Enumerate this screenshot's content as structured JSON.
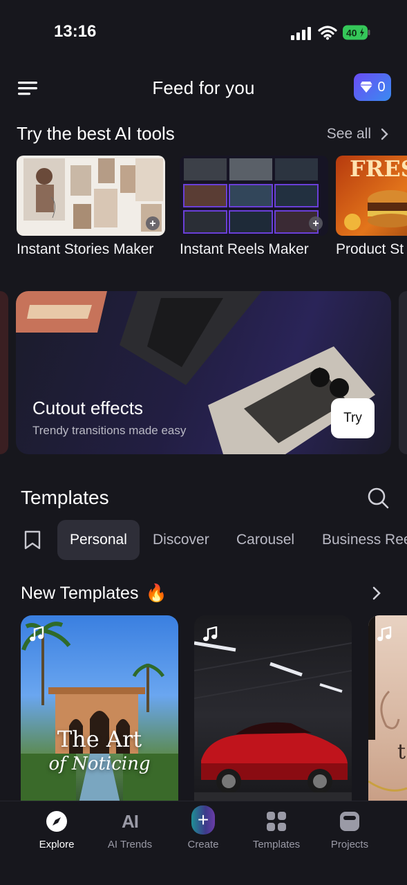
{
  "status_bar": {
    "time": "13:16",
    "battery": "40"
  },
  "header": {
    "title": "Feed for you",
    "gem_count": "0"
  },
  "ai_tools": {
    "title": "Try the best AI tools",
    "see_all": "See all",
    "items": [
      {
        "label": "Instant Stories Maker"
      },
      {
        "label": "Instant Reels Maker"
      },
      {
        "label": "Product St",
        "thumb_text": "FRESH"
      }
    ]
  },
  "banner": {
    "title": "Cutout effects",
    "subtitle": "Trendy transitions made easy",
    "button": "Try"
  },
  "templates": {
    "title": "Templates",
    "tabs": [
      "Personal",
      "Discover",
      "Carousel",
      "Business Ree"
    ],
    "active_tab": "Personal"
  },
  "new_templates": {
    "title": "New Templates",
    "emoji": "🔥",
    "cards": [
      {
        "text_main": "The Art",
        "text_sub": "of Noticing"
      },
      {
        "text_main": "",
        "text_sub": ""
      },
      {
        "text_main": "t",
        "text_sub": ""
      }
    ]
  },
  "bottom_nav": {
    "items": [
      {
        "label": "Explore",
        "icon": "compass-icon",
        "active": true
      },
      {
        "label": "AI Trends",
        "icon": "ai-icon",
        "icon_text": "AI",
        "active": false
      },
      {
        "label": "Create",
        "icon": "plus-icon",
        "icon_text": "+",
        "active": false
      },
      {
        "label": "Templates",
        "icon": "grid-icon",
        "active": false
      },
      {
        "label": "Projects",
        "icon": "projects-icon",
        "active": false
      }
    ]
  },
  "colors": {
    "background": "#17171d",
    "gem_badge": "#5a5cf3",
    "battery_green": "#35c759"
  }
}
